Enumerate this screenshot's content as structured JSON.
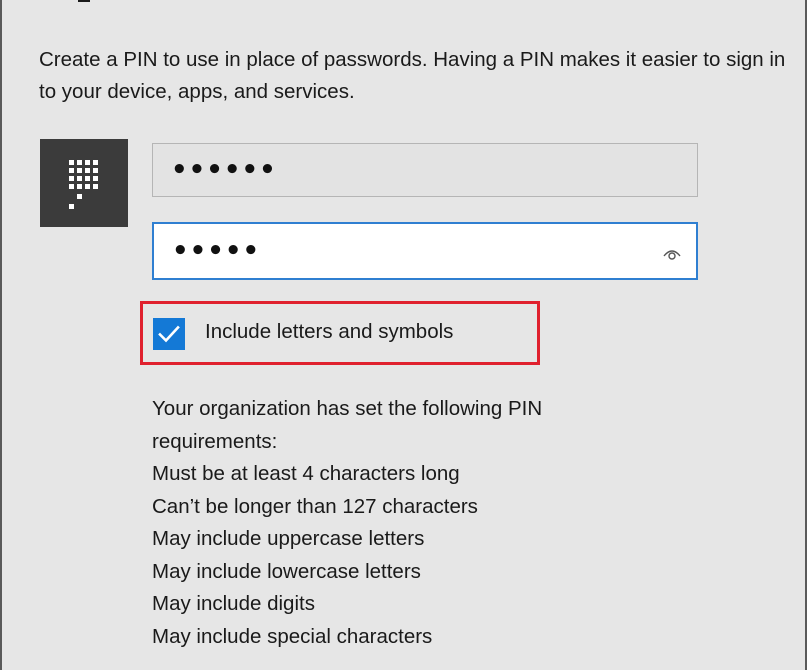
{
  "description": "Create a PIN to use in place of passwords. Having a PIN makes it easier to sign in to your device, apps, and services.",
  "pin_icon": "keypad-icon",
  "new_pin_field": {
    "value": "••••••"
  },
  "confirm_pin_field": {
    "value": "•••••",
    "reveal_icon": "eye-icon"
  },
  "include_letters_checkbox": {
    "label": "Include letters and symbols",
    "checked": true
  },
  "requirements": {
    "intro_line1": "Your organization has set the following PIN",
    "intro_line2": "requirements:",
    "items": [
      "Must be at least 4 characters long",
      "Can’t be longer than 127 characters",
      "May include uppercase letters",
      "May include lowercase letters",
      "May include digits",
      "May include special characters"
    ]
  },
  "colors": {
    "background": "#e6e6e6",
    "accent": "#1479d6",
    "highlight_border": "#e0212e",
    "icon_tile": "#3b3b3b"
  }
}
